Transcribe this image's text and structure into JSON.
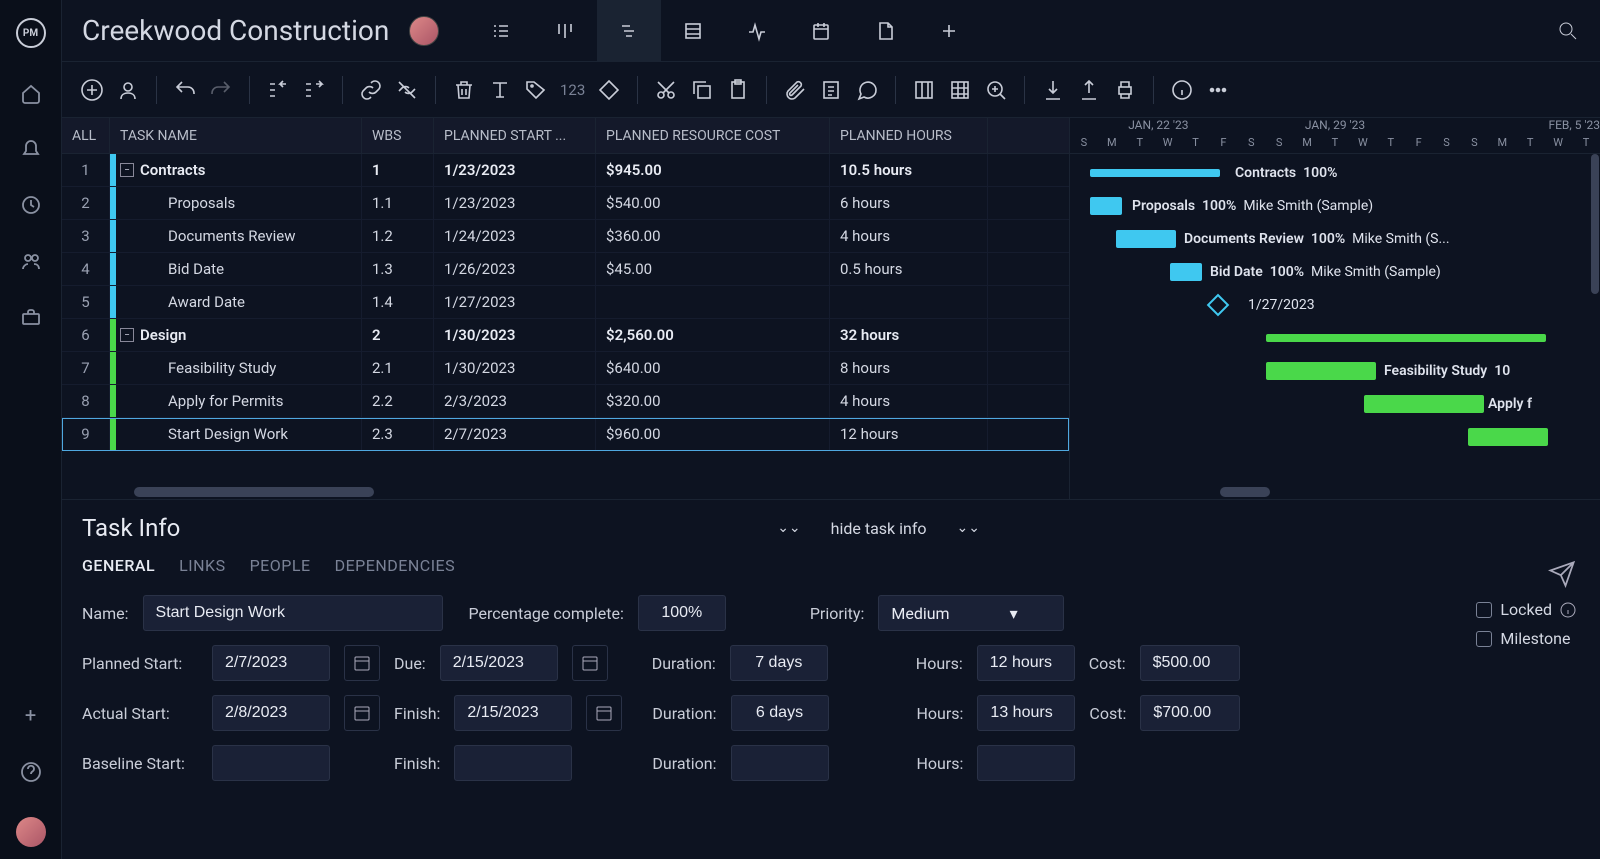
{
  "project_title": "Creekwood Construction",
  "columns": {
    "all": "ALL",
    "name": "TASK NAME",
    "wbs": "WBS",
    "start": "PLANNED START ...",
    "cost": "PLANNED RESOURCE COST",
    "hours": "PLANNED HOURS"
  },
  "rows": [
    {
      "n": "1",
      "color": "blue",
      "parent": true,
      "name": "Contracts",
      "wbs": "1",
      "start": "1/23/2023",
      "cost": "$945.00",
      "hours": "10.5 hours",
      "bold": true
    },
    {
      "n": "2",
      "color": "blue",
      "name": "Proposals",
      "wbs": "1.1",
      "start": "1/23/2023",
      "cost": "$540.00",
      "hours": "6 hours"
    },
    {
      "n": "3",
      "color": "blue",
      "name": "Documents Review",
      "wbs": "1.2",
      "start": "1/24/2023",
      "cost": "$360.00",
      "hours": "4 hours"
    },
    {
      "n": "4",
      "color": "blue",
      "name": "Bid Date",
      "wbs": "1.3",
      "start": "1/26/2023",
      "cost": "$45.00",
      "hours": "0.5 hours"
    },
    {
      "n": "5",
      "color": "blue",
      "name": "Award Date",
      "wbs": "1.4",
      "start": "1/27/2023",
      "cost": "",
      "hours": ""
    },
    {
      "n": "6",
      "color": "green",
      "parent": true,
      "name": "Design",
      "wbs": "2",
      "start": "1/30/2023",
      "cost": "$2,560.00",
      "hours": "32 hours",
      "bold": true
    },
    {
      "n": "7",
      "color": "green",
      "name": "Feasibility Study",
      "wbs": "2.1",
      "start": "1/30/2023",
      "cost": "$640.00",
      "hours": "8 hours"
    },
    {
      "n": "8",
      "color": "green",
      "name": "Apply for Permits",
      "wbs": "2.2",
      "start": "2/3/2023",
      "cost": "$320.00",
      "hours": "4 hours"
    },
    {
      "n": "9",
      "color": "green",
      "name": "Start Design Work",
      "wbs": "2.3",
      "start": "2/7/2023",
      "cost": "$960.00",
      "hours": "12 hours",
      "selected": true
    }
  ],
  "gantt": {
    "months": [
      "JAN, 22 '23",
      "JAN, 29 '23",
      "FEB, 5 '23"
    ],
    "days": [
      "S",
      "M",
      "T",
      "W",
      "T",
      "F",
      "S",
      "S",
      "M",
      "T",
      "W",
      "T",
      "F",
      "S",
      "S",
      "M",
      "T",
      "W",
      "T"
    ],
    "items": [
      {
        "name": "Contracts",
        "pct": "100%",
        "assignee": ""
      },
      {
        "name": "Proposals",
        "pct": "100%",
        "assignee": "Mike Smith (Sample)"
      },
      {
        "name": "Documents Review",
        "pct": "100%",
        "assignee": "Mike Smith (S..."
      },
      {
        "name": "Bid Date",
        "pct": "100%",
        "assignee": "Mike Smith (Sample)"
      },
      {
        "date": "1/27/2023"
      },
      {
        "name": "Feasibility Study",
        "pct": "10"
      },
      {
        "name": "Apply f"
      }
    ]
  },
  "detail": {
    "title": "Task Info",
    "hide": "hide task info",
    "tabs": [
      "GENERAL",
      "LINKS",
      "PEOPLE",
      "DEPENDENCIES"
    ],
    "labels": {
      "name": "Name:",
      "pct": "Percentage complete:",
      "priority": "Priority:",
      "pstart": "Planned Start:",
      "due": "Due:",
      "duration": "Duration:",
      "hours": "Hours:",
      "cost": "Cost:",
      "astart": "Actual Start:",
      "finish": "Finish:",
      "bstart": "Baseline Start:",
      "locked": "Locked",
      "milestone": "Milestone"
    },
    "values": {
      "name": "Start Design Work",
      "pct": "100%",
      "priority": "Medium",
      "pstart": "2/7/2023",
      "due": "2/15/2023",
      "pdur": "7 days",
      "phours": "12 hours",
      "pcost": "$500.00",
      "astart": "2/8/2023",
      "afinish": "2/15/2023",
      "adur": "6 days",
      "ahours": "13 hours",
      "acost": "$700.00"
    }
  },
  "toolbar_num": "123"
}
